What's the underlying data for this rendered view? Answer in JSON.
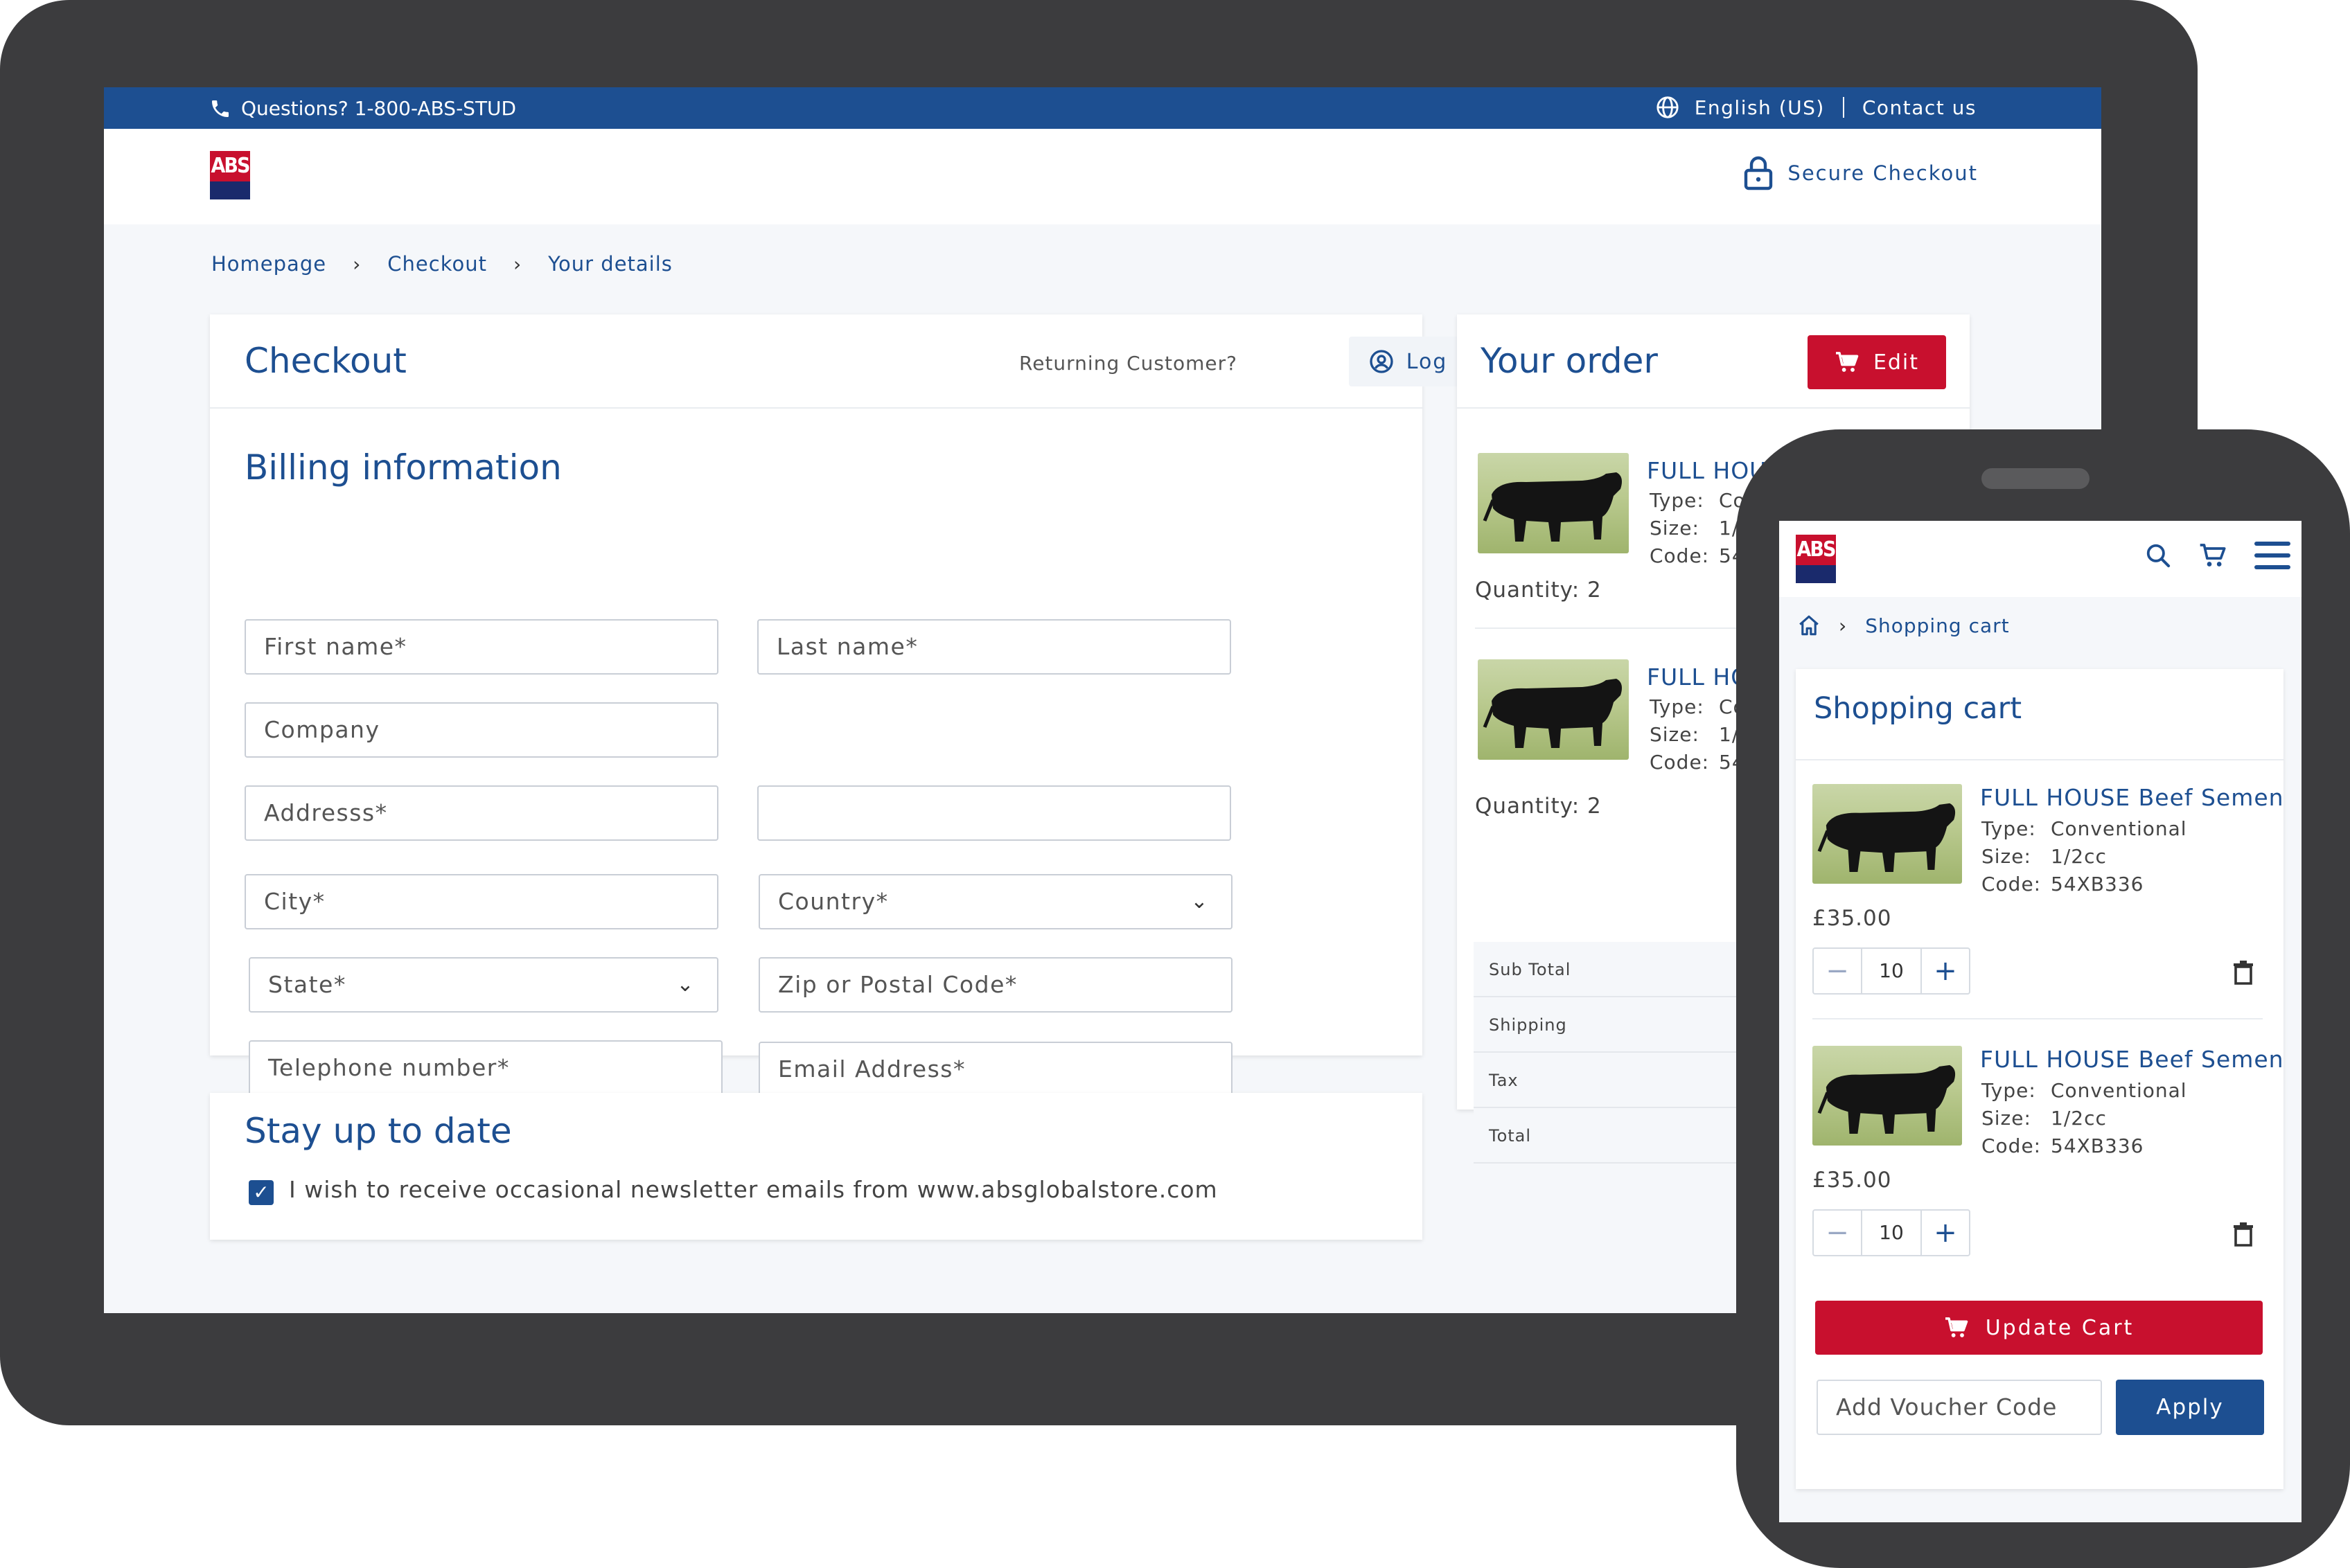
{
  "topbar": {
    "phone_text": "Questions? 1-800-ABS-STUD",
    "language": "English (US)",
    "contact": "Contact us"
  },
  "logo_text": "ABS",
  "header": {
    "secure_checkout": "Secure Checkout"
  },
  "breadcrumb": [
    "Homepage",
    "Checkout",
    "Your details"
  ],
  "checkout": {
    "title": "Checkout",
    "returning_customer": "Returning Customer?",
    "login_label": "Log in",
    "billing_title": "Billing information",
    "fields": {
      "first_name": "First name*",
      "last_name": "Last name*",
      "company": "Company",
      "address": "Addresss*",
      "address2": "",
      "city": "City*",
      "country": "Country*",
      "state": "State*",
      "zip": "Zip or Postal Code*",
      "telephone": "Telephone number*",
      "email": "Email Address*"
    }
  },
  "newsletter": {
    "title": "Stay up to date",
    "checkbox_checked": true,
    "label": "I wish to receive occasional newsletter emails from www.absglobalstore.com"
  },
  "order": {
    "title": "Your order",
    "edit_label": "Edit",
    "items": [
      {
        "name": "FULL HOUS",
        "type_label": "Type:",
        "type_value": "Co",
        "size_label": "Size:",
        "size_value": "1/",
        "code_label": "Code:",
        "code_value": "54",
        "quantity": "Quantity: 2"
      },
      {
        "name": "FULL HO",
        "type_label": "Type:",
        "type_value": "Co",
        "size_label": "Size:",
        "size_value": "1/",
        "code_label": "Code:",
        "code_value": "54",
        "quantity": "Quantity: 2"
      }
    ],
    "totals": [
      "Sub Total",
      "Shipping",
      "Tax",
      "Total"
    ]
  },
  "mobile": {
    "breadcrumb_current": "Shopping cart",
    "cart_title": "Shopping cart",
    "items": [
      {
        "name": "FULL HOUSE Beef Semen",
        "type_label": "Type:",
        "type_value": "Conventional",
        "size_label": "Size:",
        "size_value": "1/2cc",
        "code_label": "Code:",
        "code_value": "54XB336",
        "price": "£35.00",
        "quantity": "10"
      },
      {
        "name": "FULL HOUSE Beef Semen",
        "type_label": "Type:",
        "type_value": "Conventional",
        "size_label": "Size:",
        "size_value": "1/2cc",
        "code_label": "Code:",
        "code_value": "54XB336",
        "price": "£35.00",
        "quantity": "10"
      }
    ],
    "stepper_minus": "−",
    "stepper_plus": "+",
    "update_cart": "Update Cart",
    "voucher_placeholder": "Add Voucher Code",
    "apply": "Apply"
  },
  "icons": {
    "phone": "phone-icon",
    "globe": "globe-icon",
    "lock": "lock-icon",
    "user": "user-circle-icon",
    "cart": "cart-icon",
    "search": "search-icon",
    "menu": "hamburger-icon",
    "home": "home-icon",
    "trash": "trash-icon",
    "check": "check-icon",
    "chevron": "chevron-down-icon"
  },
  "colors": {
    "brand_blue": "#1d4f91",
    "brand_red": "#c8102e",
    "logo_navy": "#1a2a6c",
    "device": "#3c3c3e"
  }
}
